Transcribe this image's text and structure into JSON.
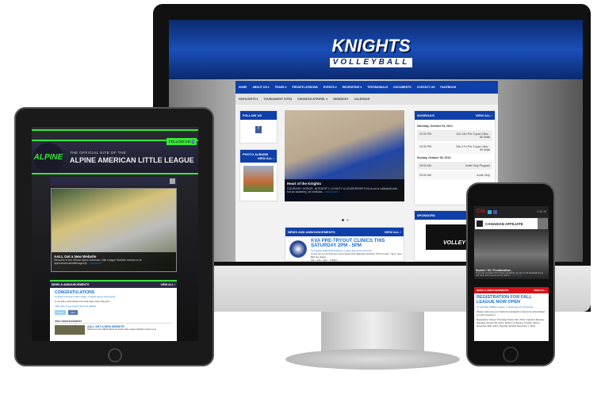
{
  "desktop": {
    "logo": {
      "title": "KNIGHTS",
      "subtitle": "VOLLEYBALL"
    },
    "nav": [
      "HOME",
      "ABOUT US ▾",
      "TEAMS ▾",
      "PRIVATE LESSONS",
      "EVENTS ▾",
      "RECRUITING ▾",
      "TESTIMONIALS",
      "DOCUMENTS",
      "CONTACT US",
      "FACEBOOK"
    ],
    "subnav": [
      "HIGHLIGHTS ▾",
      "TOURNAMENT SITES",
      "DUNGEON APPAREL ▾",
      "WINDBODY",
      "CALENDAR"
    ],
    "follow_us": "FOLLOW US",
    "photo_albums": "PHOTO ALBUMS",
    "view_all": "VIEW ALL ›",
    "slide": {
      "title": "Heart of the Knights",
      "text": "COURAGE, HONOR, INTEGRITY, LOYALTY & LEADERSHIP KVA is not a volleyball club, but an academy, an institutio...",
      "more": "read more ›"
    },
    "news": {
      "header": "NEWS AND ANNOUNCEMENTS",
      "view_all": "VIEW ALL ›",
      "title": "KVA PRE-TRYOUT CLINICS THIS SATURDAY 2PM - 5PM",
      "byline": "by Knights Volleyball Academy, 2 days ago (0 Comments)",
      "body": "Come out to our KVA pre-tryout clinics this Saturday October 4th from 2pm - 5pm. Just $20 per player.",
      "line2": "12u - 14u - 2pm - 3:30pm"
    },
    "schedule": {
      "header": "SCHEDULE",
      "view_all": "VIEW ALL ›",
      "days": [
        {
          "date": "Saturday, October 04, 2014",
          "events": [
            {
              "time": "02:00 PM",
              "name": "12U-14U Pre-Tryout Clinic - All Skills"
            },
            {
              "time": "03:30 PM",
              "name": "15U-17U Pre-Tryout Clinic - All Skills"
            }
          ]
        },
        {
          "date": "Sunday, October 05, 2014",
          "events": [
            {
              "time": "09:00 AM",
              "name": "Invite Only Program"
            },
            {
              "time": "09:00 AM",
              "name": "Invite Only"
            }
          ]
        }
      ]
    },
    "sponsors": "SPONSORS",
    "sponsor_text": "VOLLEY"
  },
  "tablet": {
    "kicker": "THE OFFICIAL SITE OF THE",
    "title": "ALPINE AMERICAN LITTLE LEAGUE",
    "follow": "FOLLOW US!",
    "logo": "ALPINE",
    "slide": {
      "title": "AALL Get a New Website",
      "text": "Welcome to the Official Alpine American Little League Website contact us at alpineamericanlittleleague@...",
      "more": "read more ›"
    },
    "news_header": "NEWS & ANNOUNCEMENTS",
    "view_all": "VIEW ALL ›",
    "post": {
      "title": "CONGRATULATIONS",
      "byline": "by Alpine American Little League, 2 weeks ago (0 Comments)",
      "body": "to our AALL 2014 Allstar and Tuttle Starr Team Players!!!",
      "link": "Click Here to see a list of all of our allstars",
      "tweet": "Tweet",
      "like": "Like"
    },
    "prev_header": "PREV ANNOUNCEMENTS",
    "prev": {
      "title": "AALL GET A NEW WEBSITE",
      "text": "Welcome to the Official Alpine American Little League Website contact us at"
    }
  },
  "phone": {
    "logo": "CAL",
    "login": "LOG IN",
    "site": "CANADIAN AFFILIATE",
    "slide": {
      "title": "Scotch / XX / Fredbreather...",
      "text": "If you can complete 7/5 of these standards, you are on 30 standards if you can work, then you are on the road to...",
      "more": "read more"
    },
    "news_header": "NEWS & ANNOUNCEMENTS",
    "view_all": "VIEW ALL ›",
    "post": {
      "title": "REGISTRATION FOR FALL LEAGUE NOW OPEN",
      "byline": "by Canadian Affiliate League, 7 weeks ago (0 Comments)",
      "body": "Please make sure you check the standards to determine what division you will compete in.",
      "details": "Registration Closes: Thursday October 9th, 2014 / Captains Meeting: Saturday October 18, 2014 / Week 1 to Week 6: October 19th to November 30th, 2014 / Playoffs: Sunday December 7, 2014"
    }
  },
  "colors": {
    "knights_blue": "#0f3fa8",
    "alpine_green": "#39e639",
    "cal_red": "#d4141a"
  }
}
